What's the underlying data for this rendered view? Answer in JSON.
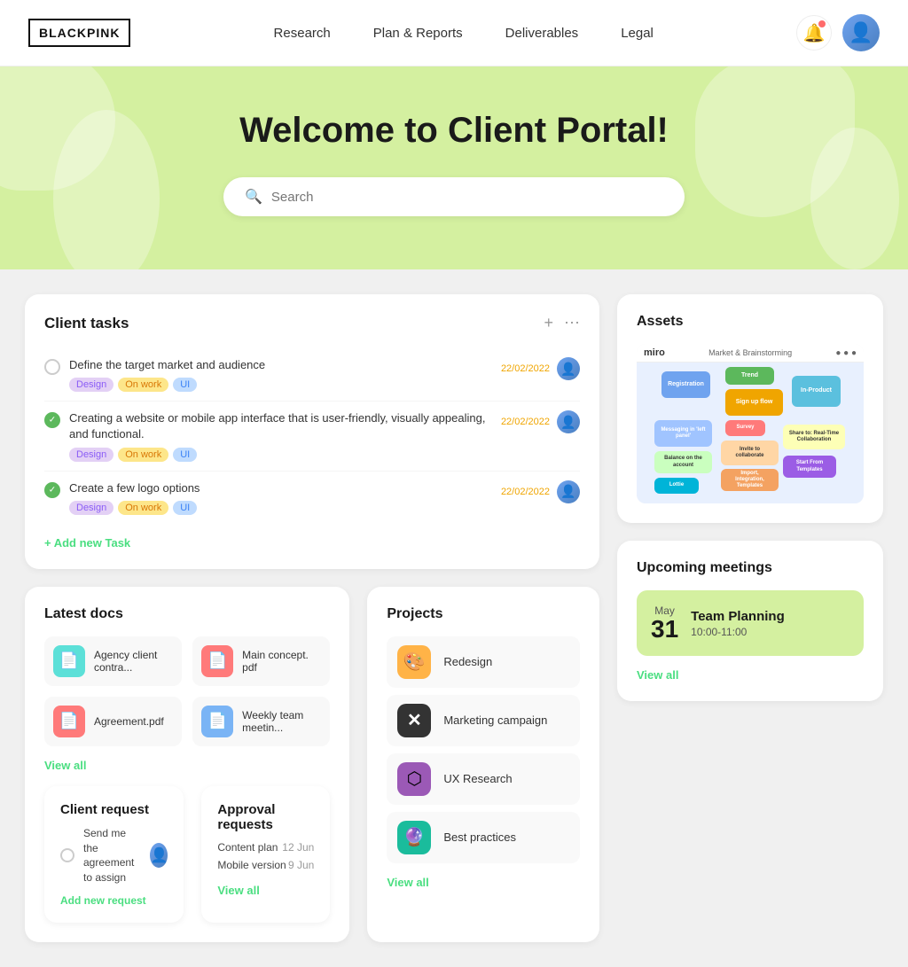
{
  "brand": {
    "logo": "BLACKPINK"
  },
  "nav": {
    "items": [
      {
        "label": "Research",
        "id": "research"
      },
      {
        "label": "Plan & Reports",
        "id": "plan-reports"
      },
      {
        "label": "Deliverables",
        "id": "deliverables"
      },
      {
        "label": "Legal",
        "id": "legal"
      }
    ]
  },
  "hero": {
    "title": "Welcome to Client Portal!",
    "search_placeholder": "Search"
  },
  "client_tasks": {
    "title": "Client tasks",
    "tasks": [
      {
        "text": "Define the target market and audience",
        "done": false,
        "tags": [
          "Design",
          "On work",
          "UI"
        ],
        "date": "22/02/2022"
      },
      {
        "text": "Creating a website or mobile app interface that is user-friendly, visually appealing, and functional.",
        "done": true,
        "tags": [
          "Design",
          "On work",
          "UI"
        ],
        "date": "22/02/2022"
      },
      {
        "text": "Create a few logo options",
        "done": true,
        "tags": [
          "Design",
          "On work",
          "UI"
        ],
        "date": "22/02/2022"
      }
    ],
    "add_label": "+ Add new Task"
  },
  "assets": {
    "title": "Assets"
  },
  "latest_docs": {
    "title": "Latest docs",
    "docs": [
      {
        "name": "Agency client contra...",
        "icon_type": "teal"
      },
      {
        "name": "Main concept. pdf",
        "icon_type": "red"
      },
      {
        "name": "Agreement.pdf",
        "icon_type": "red"
      },
      {
        "name": "Weekly team meetin...",
        "icon_type": "blue"
      }
    ],
    "view_all": "View all"
  },
  "projects": {
    "title": "Projects",
    "items": [
      {
        "name": "Redesign",
        "icon": "🎨",
        "color": "orange"
      },
      {
        "name": "Marketing campaign",
        "icon": "✖",
        "color": "dark"
      },
      {
        "name": "UX Research",
        "icon": "⬡",
        "color": "purple"
      },
      {
        "name": "Best practices",
        "icon": "🔮",
        "color": "teal2"
      }
    ],
    "view_all": "View all"
  },
  "client_request": {
    "title": "Client request",
    "request_text": "Send me the agreement to assign",
    "add_label": "Add new request"
  },
  "approval_requests": {
    "title": "Approval requests",
    "items": [
      {
        "name": "Content plan",
        "date": "12 Jun"
      },
      {
        "name": "Mobile version",
        "date": "9 Jun"
      }
    ],
    "view_all": "View all"
  },
  "upcoming_meetings": {
    "title": "Upcoming meetings",
    "month": "May",
    "day": "31",
    "meeting_name": "Team Planning",
    "meeting_time": "10:00-11:00",
    "view_all": "View all"
  },
  "colors": {
    "accent_green": "#4ade80",
    "hero_bg": "#d4f0a0",
    "date_orange": "#f0a500"
  }
}
